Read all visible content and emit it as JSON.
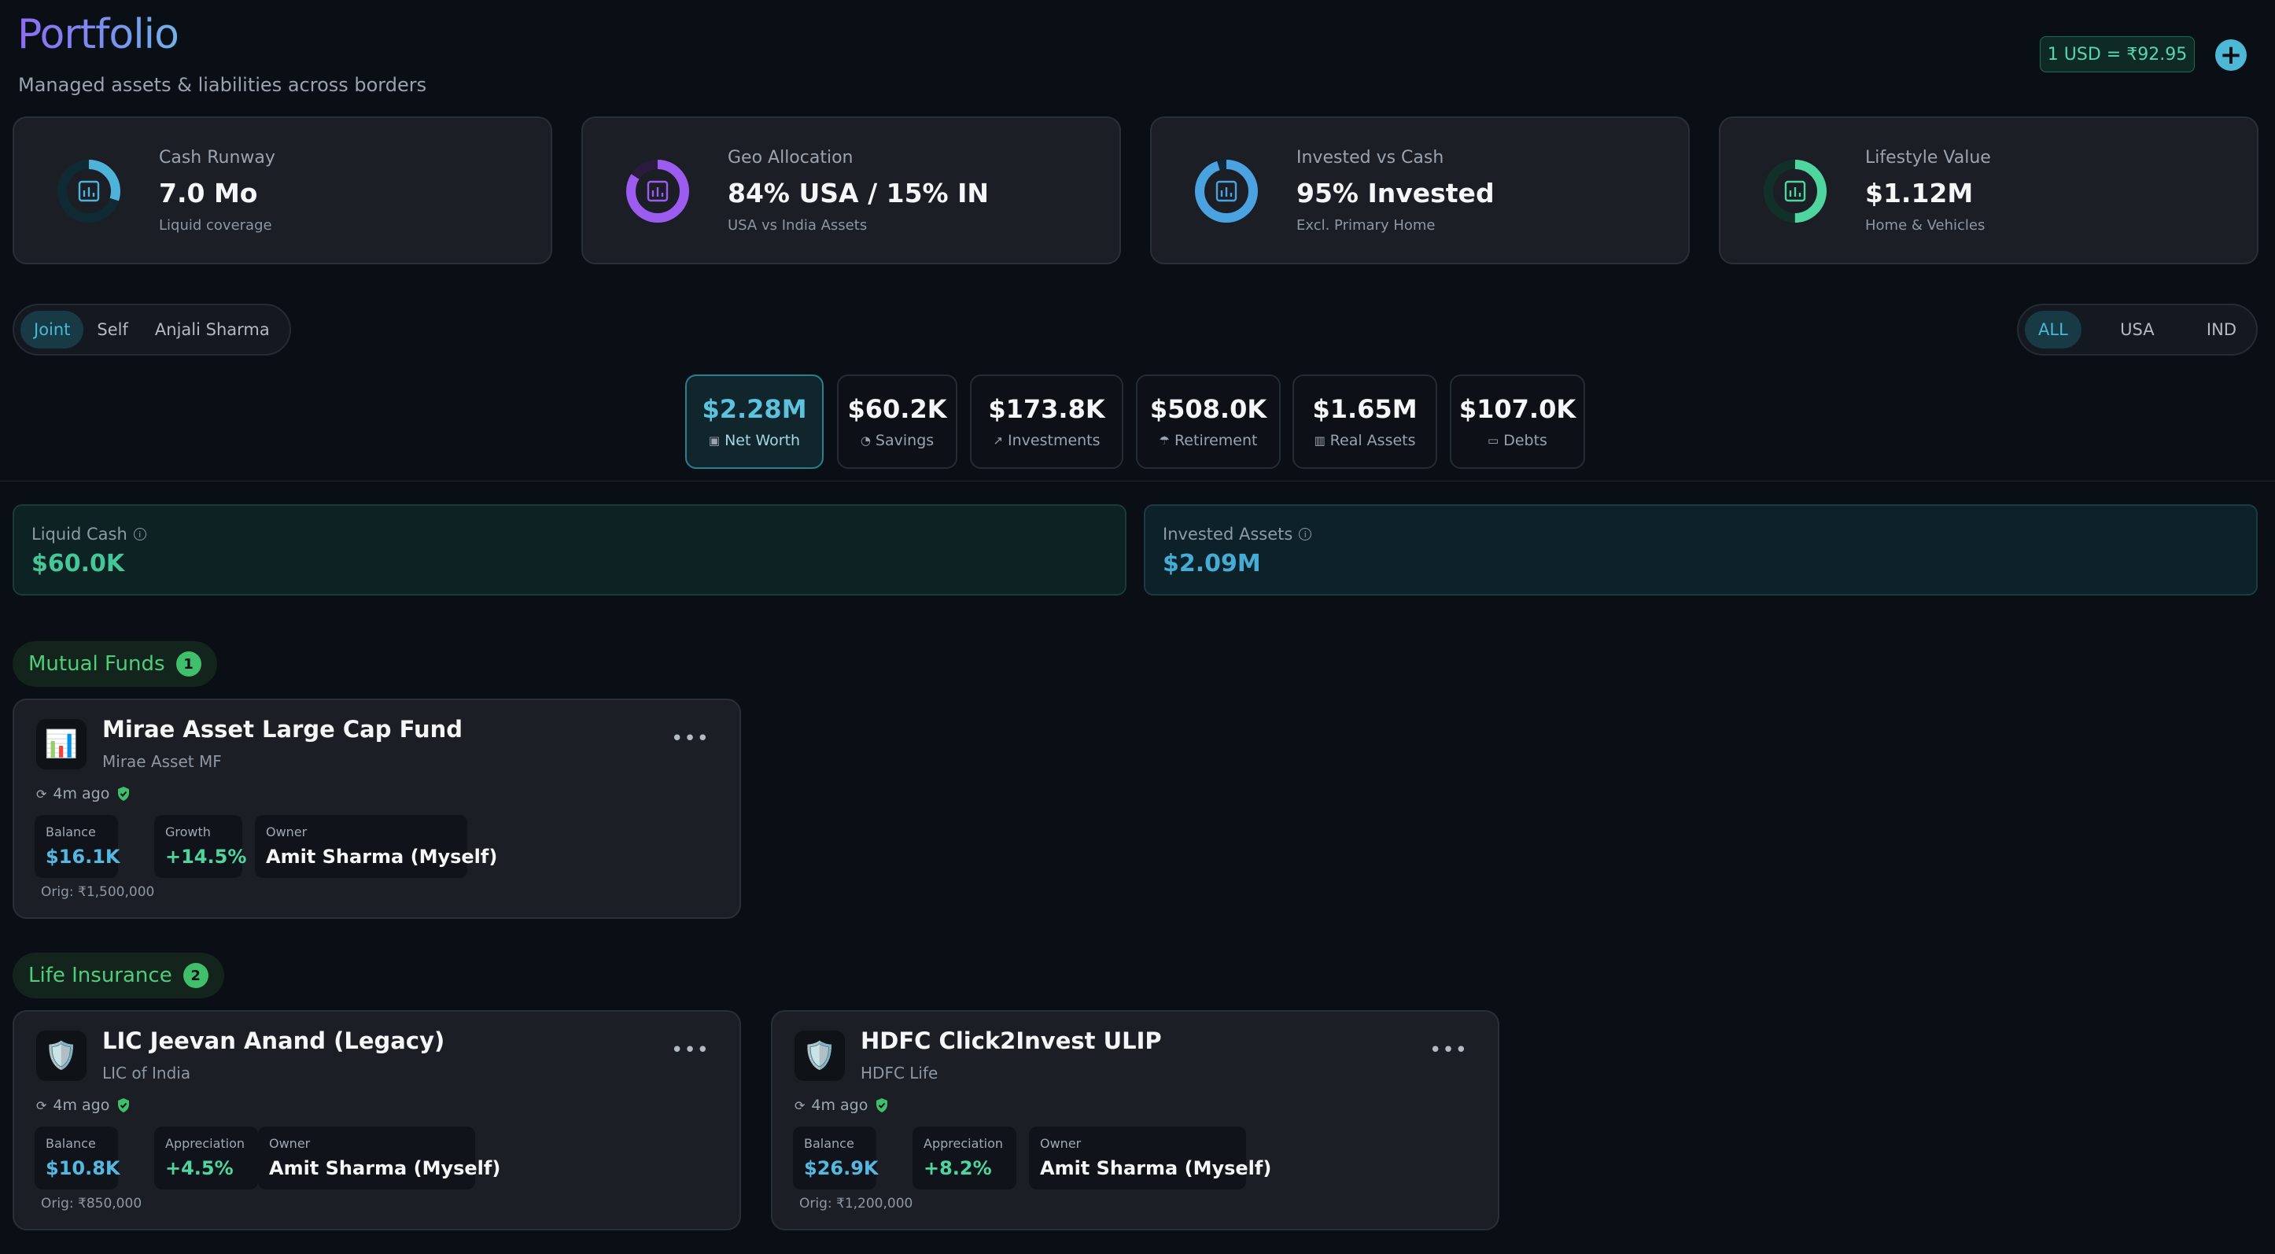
{
  "header": {
    "title": "Portfolio",
    "subtitle": "Managed assets & liabilities across borders",
    "fx_rate": "1 USD = ₹92.95",
    "add_icon": "plus-icon"
  },
  "kpis": [
    {
      "label": "Cash Runway",
      "value": "7.0 Mo",
      "sub": "Liquid coverage",
      "fill": 0.3,
      "color": "#4fb3d9",
      "icon": "chart-icon"
    },
    {
      "label": "Geo Allocation",
      "value": "84% USA / 15% IN",
      "sub": "USA vs India Assets",
      "fill": 0.84,
      "color": "#9d5cf0",
      "icon": "chart-icon"
    },
    {
      "label": "Invested vs Cash",
      "value": "95% Invested",
      "sub": "Excl. Primary Home",
      "fill": 0.95,
      "color": "#4aa3e0",
      "icon": "chart-icon"
    },
    {
      "label": "Lifestyle Value",
      "value": "$1.12M",
      "sub": "Home & Vehicles",
      "fill": 0.5,
      "color": "#4fd6a0",
      "icon": "chart-icon"
    }
  ],
  "owner_filter": {
    "options": [
      "Joint",
      "Self",
      "Anjali Sharma"
    ],
    "selected": "Joint"
  },
  "region_filter": {
    "options": [
      "ALL",
      "USA",
      "IND"
    ],
    "selected": "ALL"
  },
  "metric_tabs": [
    {
      "value": "$2.28M",
      "label": "Net Worth",
      "icon": "wallet-icon",
      "glyph": "▣"
    },
    {
      "value": "$60.2K",
      "label": "Savings",
      "icon": "piggy-bank-icon",
      "glyph": "◔"
    },
    {
      "value": "$173.8K",
      "label": "Investments",
      "icon": "trend-up-icon",
      "glyph": "↗"
    },
    {
      "value": "$508.0K",
      "label": "Retirement",
      "icon": "umbrella-icon",
      "glyph": "☂"
    },
    {
      "value": "$1.65M",
      "label": "Real Assets",
      "icon": "building-icon",
      "glyph": "▥"
    },
    {
      "value": "$107.0K",
      "label": "Debts",
      "icon": "credit-card-icon",
      "glyph": "▭"
    }
  ],
  "summary": {
    "liquid_cash": {
      "label": "Liquid Cash",
      "value": "$60.0K"
    },
    "invested_assets": {
      "label": "Invested Assets",
      "value": "$2.09M"
    }
  },
  "sections": {
    "mutual_funds": {
      "label": "Mutual Funds",
      "count": "1",
      "cards": [
        {
          "name": "Mirae Asset Large Cap Fund",
          "provider": "Mirae Asset MF",
          "icon": "bar-chart-emoji-icon",
          "glyph": "📊",
          "synced": "4m ago",
          "stats": [
            {
              "label": "Balance",
              "value": "$16.1K"
            },
            {
              "label": "Growth",
              "value": "+14.5%"
            },
            {
              "label": "Owner",
              "value": "Amit Sharma (Myself)"
            }
          ],
          "orig": "Orig: ₹1,500,000"
        }
      ]
    },
    "life_insurance": {
      "label": "Life Insurance",
      "count": "2",
      "cards": [
        {
          "name": "LIC Jeevan Anand (Legacy)",
          "provider": "LIC of India",
          "icon": "shield-emoji-icon",
          "glyph": "🛡️",
          "synced": "4m ago",
          "stats": [
            {
              "label": "Balance",
              "value": "$10.8K"
            },
            {
              "label": "Appreciation",
              "value": "+4.5%"
            },
            {
              "label": "Owner",
              "value": "Amit Sharma (Myself)"
            }
          ],
          "orig": "Orig: ₹850,000"
        },
        {
          "name": "HDFC Click2Invest ULIP",
          "provider": "HDFC Life",
          "icon": "shield-emoji-icon",
          "glyph": "🛡️",
          "synced": "4m ago",
          "stats": [
            {
              "label": "Balance",
              "value": "$26.9K"
            },
            {
              "label": "Appreciation",
              "value": "+8.2%"
            },
            {
              "label": "Owner",
              "value": "Amit Sharma (Myself)"
            }
          ],
          "orig": "Orig: ₹1,200,000"
        }
      ]
    }
  }
}
